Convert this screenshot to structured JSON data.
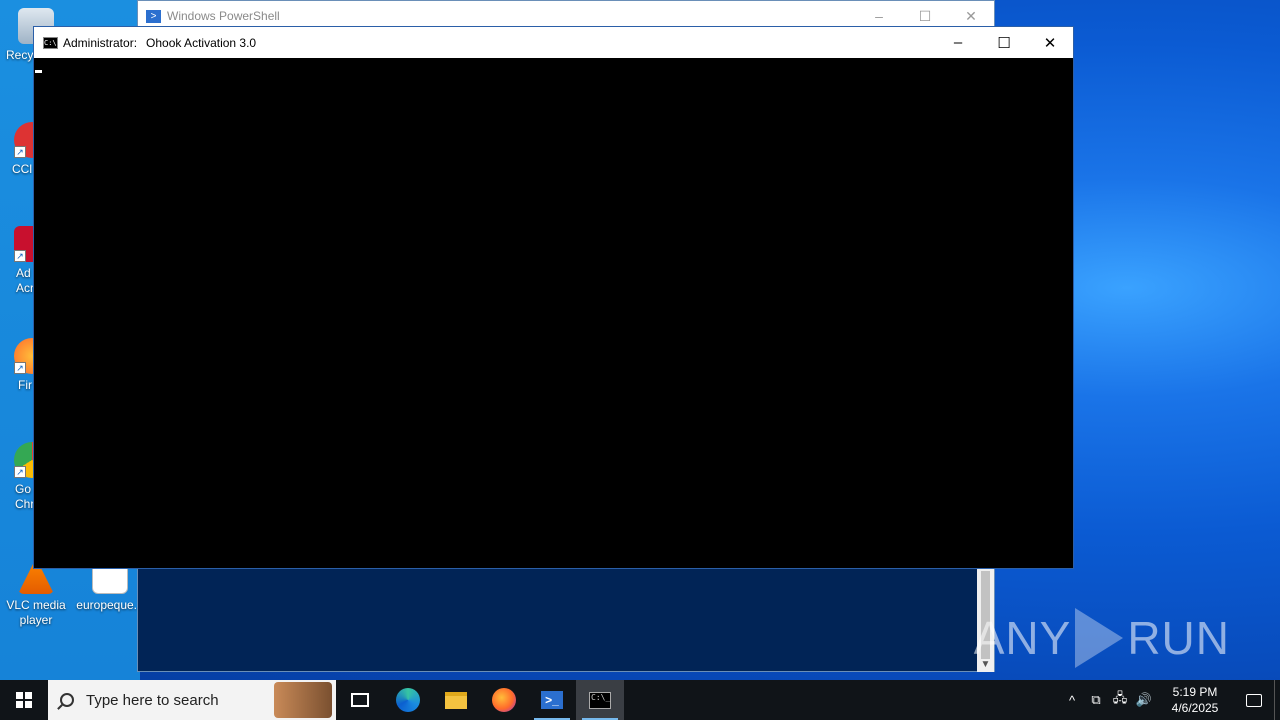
{
  "desktop": {
    "icons": [
      {
        "label": "Recy",
        "icon": "recycle-bin-icon"
      },
      {
        "label": "CCl",
        "icon": "ccleaner-icon"
      },
      {
        "label": "Ad\nAcr",
        "icon": "acrobat-icon"
      },
      {
        "label": "Fir",
        "icon": "firefox-icon"
      },
      {
        "label": "Go\nChr",
        "icon": "chrome-icon"
      },
      {
        "label": "VLC media player",
        "icon": "vlc-icon"
      },
      {
        "label": "europeque...",
        "icon": "word-doc-icon"
      }
    ]
  },
  "powershell_window": {
    "title": "Windows PowerShell",
    "icon": "powershell-icon",
    "bg_color": "#012456"
  },
  "cmd_window": {
    "title_prefix": "Administrator:",
    "title": "Ohook Activation 3.0",
    "icon": "cmd-icon",
    "bg_color": "#000000"
  },
  "window_controls": {
    "minimize": "–",
    "maximize": "☐",
    "close": "✕"
  },
  "watermark": {
    "left": "ANY",
    "right": "RUN"
  },
  "taskbar": {
    "search_placeholder": "Type here to search",
    "apps": [
      "task-view-icon",
      "edge-icon",
      "file-explorer-icon",
      "firefox-icon",
      "powershell-icon",
      "cmd-icon"
    ],
    "clock_time": "5:19 PM",
    "clock_date": "4/6/2025",
    "tray_chevron": "^"
  }
}
